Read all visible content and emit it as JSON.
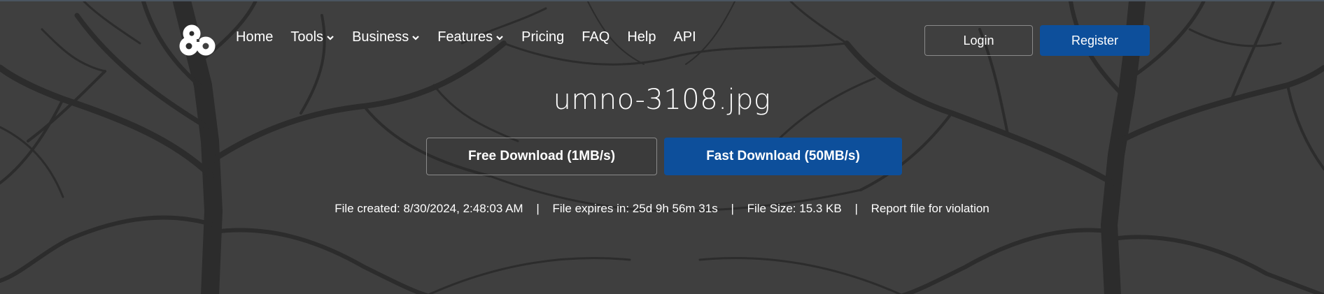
{
  "brand": {
    "logo_icon": "ampersand-cloud-logo"
  },
  "nav": {
    "items": [
      {
        "label": "Home",
        "has_dropdown": false
      },
      {
        "label": "Tools",
        "has_dropdown": true
      },
      {
        "label": "Business",
        "has_dropdown": true
      },
      {
        "label": "Features",
        "has_dropdown": true
      },
      {
        "label": "Pricing",
        "has_dropdown": false
      },
      {
        "label": "FAQ",
        "has_dropdown": false
      },
      {
        "label": "Help",
        "has_dropdown": false
      },
      {
        "label": "API",
        "has_dropdown": false
      }
    ]
  },
  "auth": {
    "login_label": "Login",
    "register_label": "Register"
  },
  "file": {
    "name": "umno-3108.jpg",
    "created": "File created: 8/30/2024, 2:48:03 AM",
    "expires": "File expires in: 25d 9h 56m 31s",
    "size": "File Size: 15.3 KB",
    "report": "Report file for violation",
    "separator": "|"
  },
  "downloads": {
    "free_label": "Free Download (1MB/s)",
    "fast_label": "Fast Download (50MB/s)"
  },
  "colors": {
    "accent": "#0d4f9b",
    "background": "#3b3b3b",
    "text": "#ffffff"
  }
}
